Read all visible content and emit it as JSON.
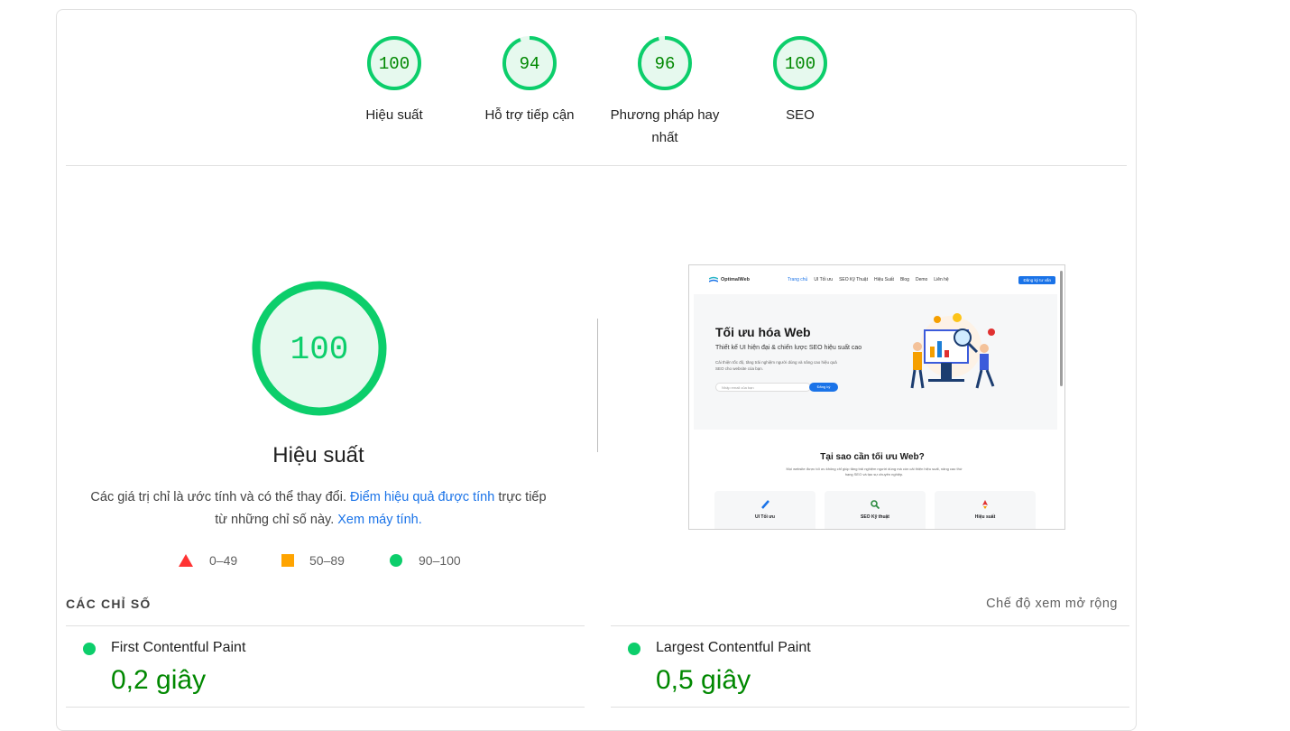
{
  "top_scores": [
    {
      "score": "100",
      "label": "Hiệu suất",
      "fraction": 1.0
    },
    {
      "score": "94",
      "label": "Hỗ trợ tiếp cận",
      "fraction": 0.94
    },
    {
      "score": "96",
      "label": "Phương pháp hay nhất",
      "fraction": 0.96
    },
    {
      "score": "100",
      "label": "SEO",
      "fraction": 1.0
    }
  ],
  "performance": {
    "score": "100",
    "fraction": 1.0,
    "title": "Hiệu suất",
    "desc_1": "Các giá trị chỉ là ước tính và có thể thay đổi.",
    "desc_link_1": "Điểm hiệu quả được tính",
    "desc_2": "trực tiếp từ những chỉ số này.",
    "desc_link_2": "Xem máy tính."
  },
  "legend": {
    "fail": "0–49",
    "average": "50–89",
    "pass": "90–100"
  },
  "screenshot": {
    "brand": "OptimalWeb",
    "nav": [
      "Trang chủ",
      "UI Tối ưu",
      "SEO Kỹ Thuật",
      "Hiệu Suất",
      "Blog",
      "Demo",
      "Liên hệ"
    ],
    "cta": "Đăng ký tư vấn",
    "hero_title": "Tối ưu hóa Web",
    "hero_sub": "Thiết kế UI hiện đại & chiến lược SEO hiệu suất cao",
    "hero_text": "Cải thiện tốc độ, tăng trải nghiệm người dùng và nâng cao hiệu quả SEO cho website của bạn.",
    "email_placeholder": "Nhập email của bạn",
    "signup": "Đăng ký",
    "section_title": "Tại sao cần tối ưu Web?",
    "section_text": "Mọi website được tối ưu không chỉ giúp tăng trải nghiệm người dùng mà còn cải thiện hiệu suất, nâng cao thứ hạng SEO và tạo sự chuyên nghiệp.",
    "features": [
      "UI Tối ưu",
      "SEO Kỹ thuật",
      "Hiệu suất"
    ]
  },
  "metrics": {
    "heading": "CÁC CHỈ SỐ",
    "expand_label": "Chế độ xem mở rộng",
    "items": [
      {
        "name": "First Contentful Paint",
        "value": "0,2 giây"
      },
      {
        "name": "Largest Contentful Paint",
        "value": "0,5 giây"
      }
    ]
  },
  "colors": {
    "pass": "#0cce6b",
    "pass_text": "#008800",
    "pass_bg": "#e6f9ee",
    "average": "#ffa400",
    "fail": "#ff3333",
    "link": "#1a73e8"
  }
}
